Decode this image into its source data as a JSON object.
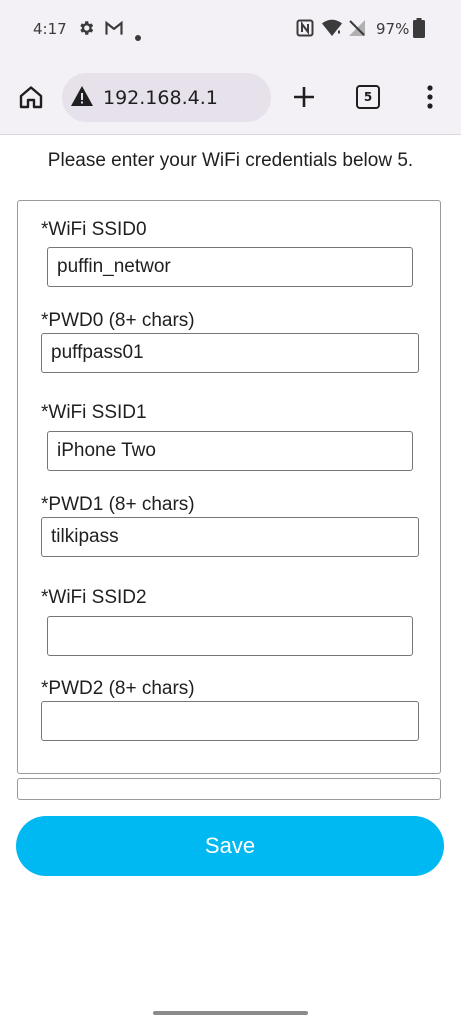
{
  "status_bar": {
    "time": "4:17",
    "battery": "97%"
  },
  "browser": {
    "url": "192.168.4.1",
    "tab_count": "5"
  },
  "page": {
    "intro": "Please enter your WiFi credentials below 5.",
    "fields": [
      {
        "label": "*WiFi SSID0",
        "value": "puffin_networ"
      },
      {
        "label": "*PWD0 (8+ chars)",
        "value": "puffpass01"
      },
      {
        "label": "*WiFi SSID1",
        "value": "iPhone Two"
      },
      {
        "label": "*PWD1 (8+ chars)",
        "value": "tilkipass"
      },
      {
        "label": "*WiFi SSID2",
        "value": ""
      },
      {
        "label": "*PWD2 (8+ chars)",
        "value": ""
      }
    ],
    "save_label": "Save"
  },
  "colors": {
    "accent": "#00b9f2",
    "chrome": "#f3f0f6"
  }
}
